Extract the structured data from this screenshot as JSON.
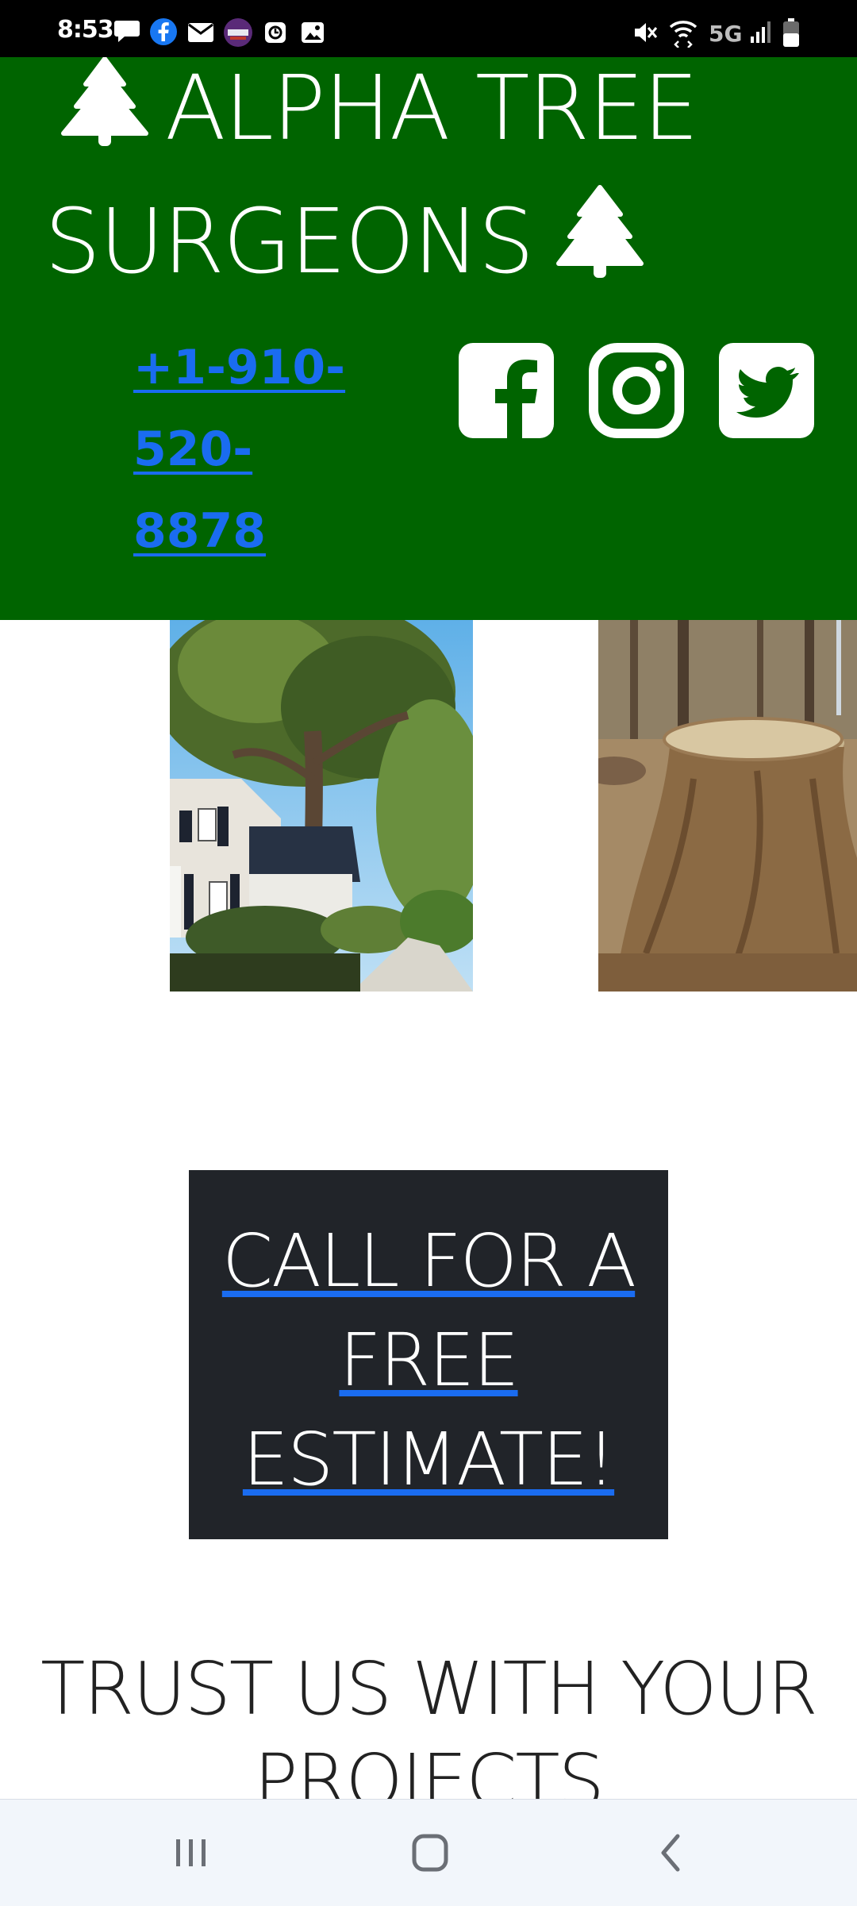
{
  "status_bar": {
    "time": "8:53",
    "network": "5G",
    "left_icons": [
      "chat-bubble-icon",
      "facebook-icon",
      "mail-icon",
      "poster-app-icon",
      "clock-app-icon",
      "gallery-icon"
    ],
    "right_icons": [
      "mute-icon",
      "wifi-icon",
      "signal-icon",
      "battery-icon"
    ]
  },
  "header": {
    "background": "#006400",
    "title_line1": "ALPHA TREE",
    "title_line2": "SURGEONS",
    "phone": "+1-910-520-8878",
    "social": [
      "facebook",
      "instagram",
      "twitter"
    ]
  },
  "gallery": [
    {
      "subject": "tree beside white house"
    },
    {
      "subject": "large tree stump"
    }
  ],
  "cta": {
    "label": "CALL FOR A FREE ESTIMATE!",
    "background": "#212429",
    "underline_color": "#1a6cf0"
  },
  "section": {
    "heading": "TRUST US WITH YOUR PROJECTS"
  },
  "nav_bar": {
    "buttons": [
      "recents",
      "home",
      "back"
    ]
  },
  "colors": {
    "link": "#1a6cf0",
    "brand_green": "#006400"
  }
}
